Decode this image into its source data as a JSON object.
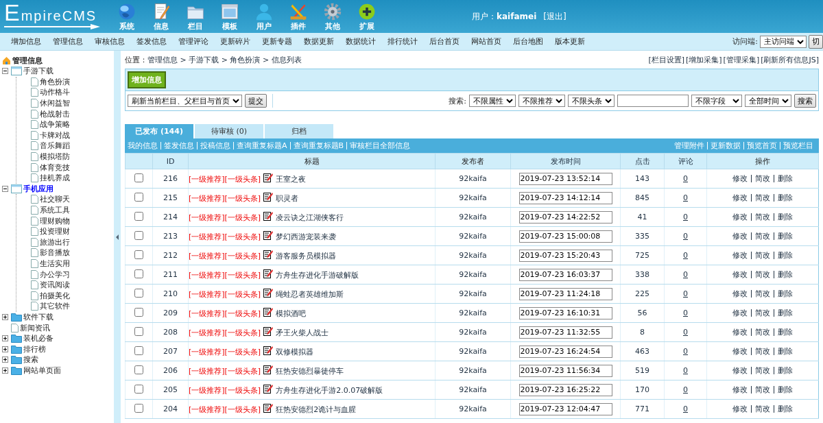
{
  "header": {
    "logo": "EmpireCMS",
    "modules": [
      {
        "label": "系统"
      },
      {
        "label": "信息"
      },
      {
        "label": "栏目"
      },
      {
        "label": "模板"
      },
      {
        "label": "用户"
      },
      {
        "label": "插件"
      },
      {
        "label": "其他"
      },
      {
        "label": "扩展"
      }
    ],
    "user": "用户：**kaifamei**",
    "logout": "[退出]"
  },
  "nav": {
    "items": [
      "增加信息",
      "管理信息",
      "审核信息",
      "签发信息",
      "管理评论",
      "更新碎片",
      "更新专题",
      "数据更新",
      "数据统计",
      "排行统计",
      "后台首页",
      "网站首页",
      "后台地图",
      "版本更新"
    ],
    "access_label": "访问端:",
    "access_value": "主访问端",
    "switch_button": "切"
  },
  "sidebar": {
    "root": "管理信息",
    "tree": [
      {
        "label": "手游下载",
        "expanded": true,
        "selected": false,
        "children": [
          {
            "label": "角色扮演"
          },
          {
            "label": "动作格斗"
          },
          {
            "label": "休闲益智"
          },
          {
            "label": "枪战射击"
          },
          {
            "label": "战争策略"
          },
          {
            "label": "卡牌对战"
          },
          {
            "label": "音乐舞蹈"
          },
          {
            "label": "模拟塔防"
          },
          {
            "label": "体育竞技"
          },
          {
            "label": "挂机养成"
          }
        ]
      },
      {
        "label": "手机应用",
        "expanded": true,
        "selected": true,
        "children": [
          {
            "label": "社交聊天"
          },
          {
            "label": "系统工具"
          },
          {
            "label": "理财购物"
          },
          {
            "label": "投资理财"
          },
          {
            "label": "旅游出行"
          },
          {
            "label": "影音播放"
          },
          {
            "label": "生活实用"
          },
          {
            "label": "办公学习"
          },
          {
            "label": "资讯阅读"
          },
          {
            "label": "拍摄美化"
          },
          {
            "label": "其它软件"
          }
        ]
      },
      {
        "label": "软件下载",
        "expanded": false,
        "selected": false
      },
      {
        "label": "新闻资讯"
      },
      {
        "label": "装机必备",
        "expanded": false,
        "selected": false
      },
      {
        "label": "排行榜",
        "expanded": false,
        "selected": false
      },
      {
        "label": "搜索",
        "expanded": false,
        "selected": false
      },
      {
        "label": "网站单页面",
        "expanded": false,
        "selected": false
      }
    ]
  },
  "breadcrumb": {
    "label": "位置：",
    "path": "管理信息 > 手游下载 > 角色扮演 > 信息列表"
  },
  "top_links": [
    "[栏目设置]",
    "[增加采集]",
    "[管理采集]",
    "[刷新所有信息JS]"
  ],
  "toolbar": {
    "add_button": "增加信息",
    "refresh_select": "刷新当前栏目、父栏目与首页",
    "submit_button": "提交",
    "search_label": "搜索:",
    "filters": [
      "不限属性",
      "不限推荐",
      "不限头条"
    ],
    "field_select": "不限字段",
    "time_select": "全部时间",
    "search_button": "搜索"
  },
  "tabs": [
    {
      "label": "已发布 (144)",
      "selected": true
    },
    {
      "label": "待审核 (0)",
      "selected": false
    },
    {
      "label": "归档",
      "selected": false
    }
  ],
  "link_bar": {
    "left": [
      "我的信息",
      "签发信息",
      "投稿信息",
      "查询重复标题A",
      "查询重复标题B",
      "审核栏目全部信息"
    ],
    "right": [
      "管理附件",
      "更新数据",
      "预览首页",
      "预览栏目"
    ]
  },
  "table": {
    "columns": [
      {
        "label": "ID",
        "link": true
      },
      {
        "label": "标题",
        "link": false
      },
      {
        "label": "发布者",
        "link": false
      },
      {
        "label": "发布时间",
        "link": true
      },
      {
        "label": "点击",
        "link": true
      },
      {
        "label": "评论",
        "link": true
      },
      {
        "label": "操作",
        "link": false
      }
    ],
    "rows": [
      {
        "checked": false,
        "id": "216",
        "tags": "[一级推荐][一级头条]",
        "title": "王室之夜",
        "author": "92kaifa",
        "time": "2019-07-23 13:52:14",
        "clicks": "143",
        "comments": "0",
        "actions": [
          "修改",
          "简改",
          "删除"
        ]
      },
      {
        "checked": false,
        "id": "215",
        "tags": "[一级推荐][一级头条]",
        "title": "职灵者",
        "author": "92kaifa",
        "time": "2019-07-23 14:12:14",
        "clicks": "845",
        "comments": "0",
        "actions": [
          "修改",
          "简改",
          "删除"
        ]
      },
      {
        "checked": false,
        "id": "214",
        "tags": "[一级推荐][一级头条]",
        "title": "凌云诀之江湖侠客行",
        "author": "92kaifa",
        "time": "2019-07-23 14:22:52",
        "clicks": "41",
        "comments": "0",
        "actions": [
          "修改",
          "简改",
          "删除"
        ]
      },
      {
        "checked": false,
        "id": "213",
        "tags": "[一级推荐][一级头条]",
        "title": "梦幻西游宠装来袭",
        "author": "92kaifa",
        "time": "2019-07-23 15:00:08",
        "clicks": "335",
        "comments": "0",
        "actions": [
          "修改",
          "简改",
          "删除"
        ]
      },
      {
        "checked": false,
        "id": "212",
        "tags": "[一级推荐][一级头条]",
        "title": "游客服务员模拟器",
        "author": "92kaifa",
        "time": "2019-07-23 15:20:43",
        "clicks": "725",
        "comments": "0",
        "actions": [
          "修改",
          "简改",
          "删除"
        ]
      },
      {
        "checked": false,
        "id": "211",
        "tags": "[一级推荐][一级头条]",
        "title": "方舟生存进化手游破解版",
        "author": "92kaifa",
        "time": "2019-07-23 16:03:37",
        "clicks": "338",
        "comments": "0",
        "actions": [
          "修改",
          "简改",
          "删除"
        ]
      },
      {
        "checked": false,
        "id": "210",
        "tags": "[一级推荐][一级头条]",
        "title": "绳蛙忍者英雄维加斯",
        "author": "92kaifa",
        "time": "2019-07-23 11:24:18",
        "clicks": "225",
        "comments": "0",
        "actions": [
          "修改",
          "简改",
          "删除"
        ]
      },
      {
        "checked": false,
        "id": "209",
        "tags": "[一级推荐][一级头条]",
        "title": "模拟酒吧",
        "author": "92kaifa",
        "time": "2019-07-23 16:10:31",
        "clicks": "56",
        "comments": "0",
        "actions": [
          "修改",
          "简改",
          "删除"
        ]
      },
      {
        "checked": false,
        "id": "208",
        "tags": "[一级推荐][一级头条]",
        "title": "矛王火柴人战士",
        "author": "92kaifa",
        "time": "2019-07-23 11:32:55",
        "clicks": "8",
        "comments": "0",
        "actions": [
          "修改",
          "简改",
          "删除"
        ]
      },
      {
        "checked": false,
        "id": "207",
        "tags": "[一级推荐][一级头条]",
        "title": "双修模拟器",
        "author": "92kaifa",
        "time": "2019-07-23 16:24:54",
        "clicks": "463",
        "comments": "0",
        "actions": [
          "修改",
          "简改",
          "删除"
        ]
      },
      {
        "checked": false,
        "id": "206",
        "tags": "[一级推荐][一级头条]",
        "title": "狂热安德烈暴徒停车",
        "author": "92kaifa",
        "time": "2019-07-23 11:56:34",
        "clicks": "519",
        "comments": "0",
        "actions": [
          "修改",
          "简改",
          "删除"
        ]
      },
      {
        "checked": false,
        "id": "205",
        "tags": "[一级推荐][一级头条]",
        "title": "方舟生存进化手游2.0.07破解版",
        "author": "92kaifa",
        "time": "2019-07-23 16:25:22",
        "clicks": "170",
        "comments": "0",
        "actions": [
          "修改",
          "简改",
          "删除"
        ]
      },
      {
        "checked": false,
        "id": "204",
        "tags": "[一级推荐][一级头条]",
        "title": "狂热安德烈2诡计与血腥",
        "author": "92kaifa",
        "time": "2019-07-23 12:04:47",
        "clicks": "771",
        "comments": "0",
        "actions": [
          "修改",
          "简改",
          "删除"
        ]
      }
    ]
  }
}
